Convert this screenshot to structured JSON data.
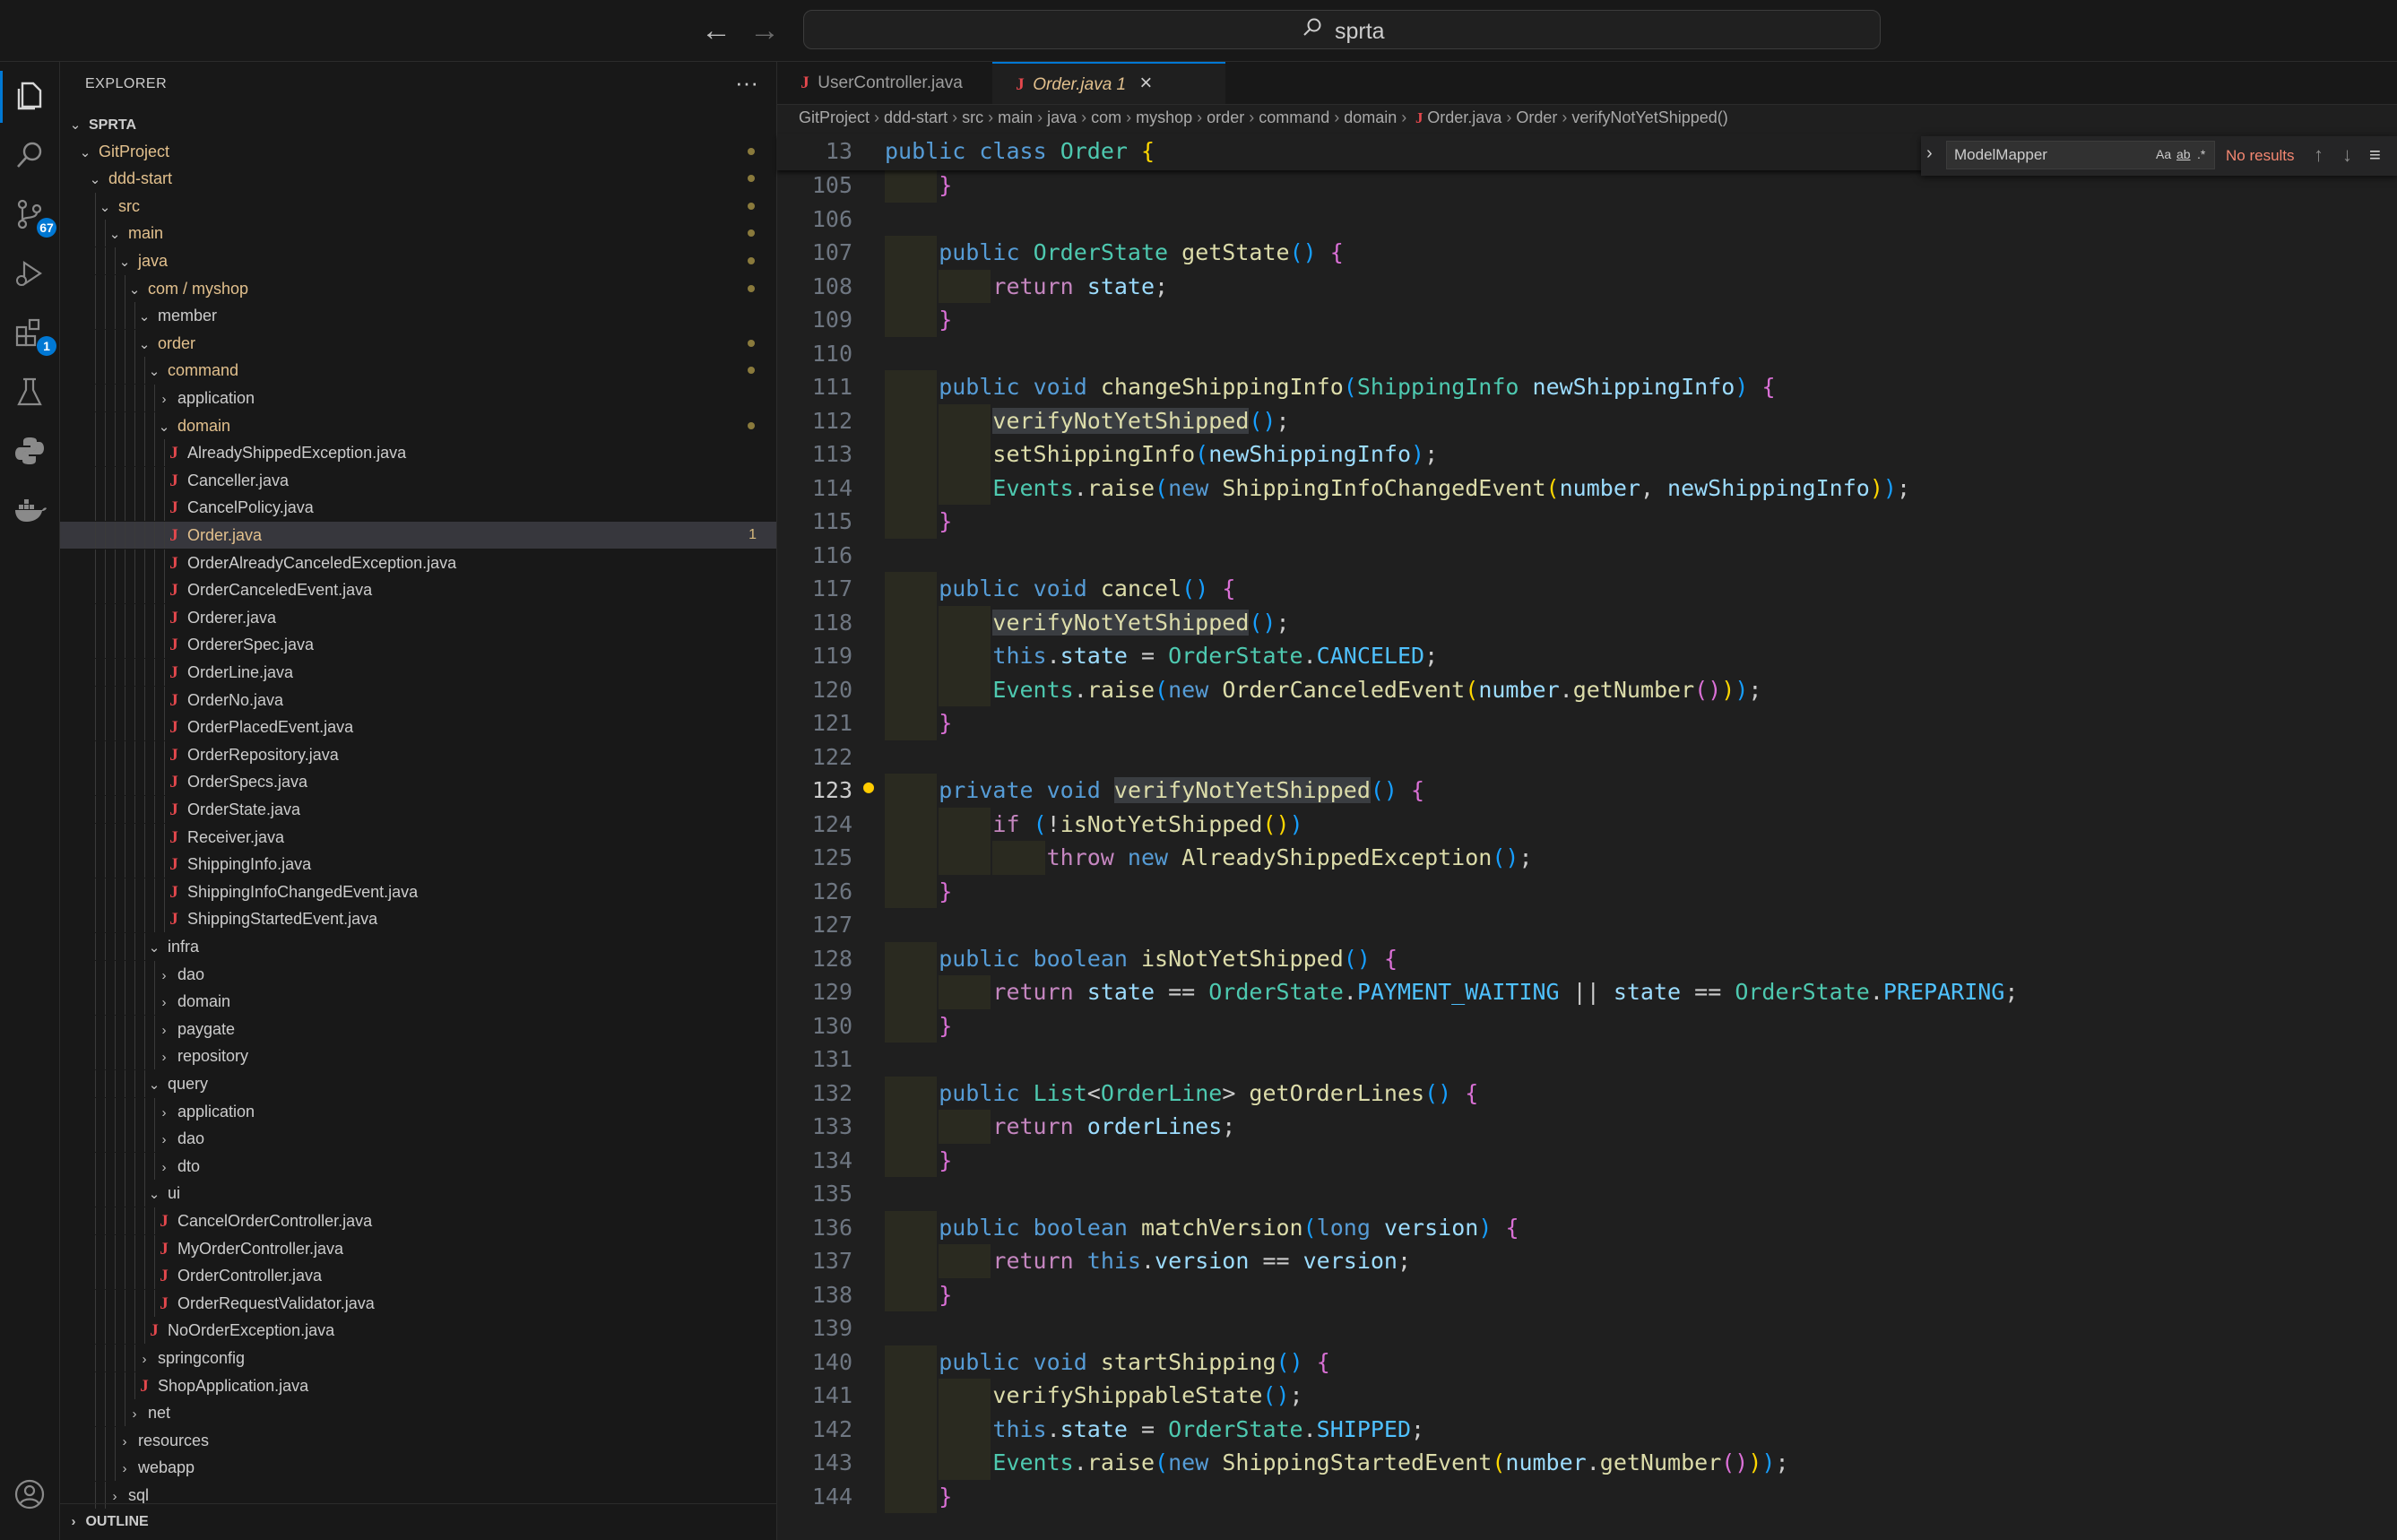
{
  "titlebar": {
    "search_text": "sprta",
    "back_icon": "arrow-left-icon",
    "forward_icon": "arrow-right-icon"
  },
  "activitybar": {
    "scm_badge": "67",
    "extensions_badge": "1"
  },
  "explorer": {
    "title": "EXPLORER",
    "more": "···",
    "outline": "OUTLINE",
    "tree": [
      {
        "label": "SPRTA",
        "depth": 0,
        "chev": "v",
        "bold": true
      },
      {
        "label": "GitProject",
        "depth": 1,
        "chev": "v",
        "mod": true,
        "dot": true
      },
      {
        "label": "ddd-start",
        "depth": 2,
        "chev": "v",
        "mod": true,
        "dot": true
      },
      {
        "label": "src",
        "depth": 3,
        "chev": "v",
        "mod": true,
        "dot": true
      },
      {
        "label": "main",
        "depth": 4,
        "chev": "v",
        "mod": true,
        "dot": true
      },
      {
        "label": "java",
        "depth": 5,
        "chev": "v",
        "mod": true,
        "dot": true
      },
      {
        "label": "com / myshop",
        "depth": 6,
        "chev": "v",
        "mod": true,
        "dot": true
      },
      {
        "label": "member",
        "depth": 7,
        "chev": "v"
      },
      {
        "label": "order",
        "depth": 7,
        "chev": "v",
        "mod": true,
        "dot": true
      },
      {
        "label": "command",
        "depth": 8,
        "chev": "v",
        "mod": true,
        "dot": true
      },
      {
        "label": "application",
        "depth": 9,
        "chev": ">"
      },
      {
        "label": "domain",
        "depth": 9,
        "chev": "v",
        "mod": true,
        "dot": true
      },
      {
        "label": "AlreadyShippedException.java",
        "depth": 10,
        "file": true
      },
      {
        "label": "Canceller.java",
        "depth": 10,
        "file": true
      },
      {
        "label": "CancelPolicy.java",
        "depth": 10,
        "file": true
      },
      {
        "label": "Order.java",
        "depth": 10,
        "file": true,
        "mod": true,
        "sel": true,
        "count": "1"
      },
      {
        "label": "OrderAlreadyCanceledException.java",
        "depth": 10,
        "file": true
      },
      {
        "label": "OrderCanceledEvent.java",
        "depth": 10,
        "file": true
      },
      {
        "label": "Orderer.java",
        "depth": 10,
        "file": true
      },
      {
        "label": "OrdererSpec.java",
        "depth": 10,
        "file": true
      },
      {
        "label": "OrderLine.java",
        "depth": 10,
        "file": true
      },
      {
        "label": "OrderNo.java",
        "depth": 10,
        "file": true
      },
      {
        "label": "OrderPlacedEvent.java",
        "depth": 10,
        "file": true
      },
      {
        "label": "OrderRepository.java",
        "depth": 10,
        "file": true
      },
      {
        "label": "OrderSpecs.java",
        "depth": 10,
        "file": true
      },
      {
        "label": "OrderState.java",
        "depth": 10,
        "file": true
      },
      {
        "label": "Receiver.java",
        "depth": 10,
        "file": true
      },
      {
        "label": "ShippingInfo.java",
        "depth": 10,
        "file": true
      },
      {
        "label": "ShippingInfoChangedEvent.java",
        "depth": 10,
        "file": true
      },
      {
        "label": "ShippingStartedEvent.java",
        "depth": 10,
        "file": true
      },
      {
        "label": "infra",
        "depth": 8,
        "chev": "v"
      },
      {
        "label": "dao",
        "depth": 9,
        "chev": ">"
      },
      {
        "label": "domain",
        "depth": 9,
        "chev": ">"
      },
      {
        "label": "paygate",
        "depth": 9,
        "chev": ">"
      },
      {
        "label": "repository",
        "depth": 9,
        "chev": ">"
      },
      {
        "label": "query",
        "depth": 8,
        "chev": "v"
      },
      {
        "label": "application",
        "depth": 9,
        "chev": ">"
      },
      {
        "label": "dao",
        "depth": 9,
        "chev": ">"
      },
      {
        "label": "dto",
        "depth": 9,
        "chev": ">"
      },
      {
        "label": "ui",
        "depth": 8,
        "chev": "v"
      },
      {
        "label": "CancelOrderController.java",
        "depth": 9,
        "file": true
      },
      {
        "label": "MyOrderController.java",
        "depth": 9,
        "file": true
      },
      {
        "label": "OrderController.java",
        "depth": 9,
        "file": true
      },
      {
        "label": "OrderRequestValidator.java",
        "depth": 9,
        "file": true
      },
      {
        "label": "NoOrderException.java",
        "depth": 8,
        "file": true
      },
      {
        "label": "springconfig",
        "depth": 7,
        "chev": ">"
      },
      {
        "label": "ShopApplication.java",
        "depth": 7,
        "file": true
      },
      {
        "label": "net",
        "depth": 6,
        "chev": ">"
      },
      {
        "label": "resources",
        "depth": 5,
        "chev": ">"
      },
      {
        "label": "webapp",
        "depth": 5,
        "chev": ">"
      },
      {
        "label": "sql",
        "depth": 4,
        "chev": ">"
      }
    ]
  },
  "tabs": [
    {
      "label": "UserController.java",
      "active": false
    },
    {
      "label": "Order.java 1",
      "active": true,
      "close": "×"
    }
  ],
  "breadcrumb": [
    "GitProject",
    "ddd-start",
    "src",
    "main",
    "java",
    "com",
    "myshop",
    "order",
    "command",
    "domain",
    "Order.java",
    "Order",
    "verifyNotYetShipped()"
  ],
  "find": {
    "query": "ModelMapper",
    "case_label": "Aa",
    "word_label": "ab",
    "regex_label": ".*",
    "result": "No results"
  },
  "sticky": {
    "line": "13",
    "html": "<span class=\"kw\">public</span> <span class=\"kw\">class</span> <span class=\"ty\">Order</span> <span class=\"pn\">{</span>"
  },
  "code": [
    {
      "n": "105",
      "i": 1,
      "html": "<span class=\"pn2\">}</span>"
    },
    {
      "n": "106",
      "i": 0,
      "html": ""
    },
    {
      "n": "107",
      "i": 1,
      "html": "<span class=\"kw\">public</span> <span class=\"ty\">OrderState</span> <span class=\"fn\">getState</span><span class=\"pn3\">()</span> <span class=\"pn2\">{</span>"
    },
    {
      "n": "108",
      "i": 2,
      "html": "<span class=\"kw2\">return</span> <span class=\"vr\">state</span>;"
    },
    {
      "n": "109",
      "i": 1,
      "html": "<span class=\"pn2\">}</span>"
    },
    {
      "n": "110",
      "i": 0,
      "html": ""
    },
    {
      "n": "111",
      "i": 1,
      "html": "<span class=\"kw\">public</span> <span class=\"kw\">void</span> <span class=\"fn\">changeShippingInfo</span><span class=\"pn3\">(</span><span class=\"ty\">ShippingInfo</span> <span class=\"vr\">newShippingInfo</span><span class=\"pn3\">)</span> <span class=\"pn2\">{</span>"
    },
    {
      "n": "112",
      "i": 2,
      "html": "<span class=\"fn hl\">verifyNotYetShipped</span><span class=\"pn3\">()</span>;"
    },
    {
      "n": "113",
      "i": 2,
      "html": "<span class=\"fn\">setShippingInfo</span><span class=\"pn3\">(</span><span class=\"vr\">newShippingInfo</span><span class=\"pn3\">)</span>;"
    },
    {
      "n": "114",
      "i": 2,
      "html": "<span class=\"ty\">Events</span>.<span class=\"fn\">raise</span><span class=\"pn3\">(</span><span class=\"kw\">new</span> <span class=\"fn\">ShippingInfoChangedEvent</span><span class=\"pn\">(</span><span class=\"vr\">number</span>, <span class=\"vr\">newShippingInfo</span><span class=\"pn\">)</span><span class=\"pn3\">)</span>;"
    },
    {
      "n": "115",
      "i": 1,
      "html": "<span class=\"pn2\">}</span>"
    },
    {
      "n": "116",
      "i": 0,
      "html": ""
    },
    {
      "n": "117",
      "i": 1,
      "html": "<span class=\"kw\">public</span> <span class=\"kw\">void</span> <span class=\"fn\">cancel</span><span class=\"pn3\">()</span> <span class=\"pn2\">{</span>"
    },
    {
      "n": "118",
      "i": 2,
      "html": "<span class=\"fn hl\">verifyNotYetShipped</span><span class=\"pn3\">()</span>;"
    },
    {
      "n": "119",
      "i": 2,
      "html": "<span class=\"kw\">this</span>.<span class=\"vr\">state</span> = <span class=\"ty\">OrderState</span>.<span class=\"cn\">CANCELED</span>;"
    },
    {
      "n": "120",
      "i": 2,
      "html": "<span class=\"ty\">Events</span>.<span class=\"fn\">raise</span><span class=\"pn3\">(</span><span class=\"kw\">new</span> <span class=\"fn\">OrderCanceledEvent</span><span class=\"pn\">(</span><span class=\"vr\">number</span>.<span class=\"fn\">getNumber</span><span class=\"pn2\">()</span><span class=\"pn\">)</span><span class=\"pn3\">)</span>;"
    },
    {
      "n": "121",
      "i": 1,
      "html": "<span class=\"pn2\">}</span>"
    },
    {
      "n": "122",
      "i": 0,
      "html": ""
    },
    {
      "n": "123",
      "i": 1,
      "cur": true,
      "bulb": true,
      "html": "<span class=\"kw\">private</span> <span class=\"kw\">void</span> <span class=\"fn hl\">verifyNotYetShipped</span><span class=\"pn3\">()</span> <span class=\"pn2\">{</span>"
    },
    {
      "n": "124",
      "i": 2,
      "html": "<span class=\"kw2\">if</span> <span class=\"pn3\">(</span>!<span class=\"fn\">isNotYetShipped</span><span class=\"pn\">()</span><span class=\"pn3\">)</span>"
    },
    {
      "n": "125",
      "i": 3,
      "html": "<span class=\"kw2\">throw</span> <span class=\"kw\">new</span> <span class=\"fn\">AlreadyShippedException</span><span class=\"pn3\">()</span>;"
    },
    {
      "n": "126",
      "i": 1,
      "html": "<span class=\"pn2\">}</span>"
    },
    {
      "n": "127",
      "i": 0,
      "html": ""
    },
    {
      "n": "128",
      "i": 1,
      "html": "<span class=\"kw\">public</span> <span class=\"kw\">boolean</span> <span class=\"fn\">isNotYetShipped</span><span class=\"pn3\">()</span> <span class=\"pn2\">{</span>"
    },
    {
      "n": "129",
      "i": 2,
      "html": "<span class=\"kw2\">return</span> <span class=\"vr\">state</span> == <span class=\"ty\">OrderState</span>.<span class=\"cn\">PAYMENT_WAITING</span> || <span class=\"vr\">state</span> == <span class=\"ty\">OrderState</span>.<span class=\"cn\">PREPARING</span>;"
    },
    {
      "n": "130",
      "i": 1,
      "html": "<span class=\"pn2\">}</span>"
    },
    {
      "n": "131",
      "i": 0,
      "html": ""
    },
    {
      "n": "132",
      "i": 1,
      "html": "<span class=\"kw\">public</span> <span class=\"ty\">List</span>&lt;<span class=\"ty\">OrderLine</span>&gt; <span class=\"fn\">getOrderLines</span><span class=\"pn3\">()</span> <span class=\"pn2\">{</span>"
    },
    {
      "n": "133",
      "i": 2,
      "html": "<span class=\"kw2\">return</span> <span class=\"vr\">orderLines</span>;"
    },
    {
      "n": "134",
      "i": 1,
      "html": "<span class=\"pn2\">}</span>"
    },
    {
      "n": "135",
      "i": 0,
      "html": ""
    },
    {
      "n": "136",
      "i": 1,
      "html": "<span class=\"kw\">public</span> <span class=\"kw\">boolean</span> <span class=\"fn\">matchVersion</span><span class=\"pn3\">(</span><span class=\"kw\">long</span> <span class=\"vr\">version</span><span class=\"pn3\">)</span> <span class=\"pn2\">{</span>"
    },
    {
      "n": "137",
      "i": 2,
      "html": "<span class=\"kw2\">return</span> <span class=\"kw\">this</span>.<span class=\"vr\">version</span> == <span class=\"vr\">version</span>;"
    },
    {
      "n": "138",
      "i": 1,
      "html": "<span class=\"pn2\">}</span>"
    },
    {
      "n": "139",
      "i": 0,
      "html": ""
    },
    {
      "n": "140",
      "i": 1,
      "html": "<span class=\"kw\">public</span> <span class=\"kw\">void</span> <span class=\"fn\">startShipping</span><span class=\"pn3\">()</span> <span class=\"pn2\">{</span>"
    },
    {
      "n": "141",
      "i": 2,
      "html": "<span class=\"fn\">verifyShippableState</span><span class=\"pn3\">()</span>;"
    },
    {
      "n": "142",
      "i": 2,
      "html": "<span class=\"kw\">this</span>.<span class=\"vr\">state</span> = <span class=\"ty\">OrderState</span>.<span class=\"cn\">SHIPPED</span>;"
    },
    {
      "n": "143",
      "i": 2,
      "html": "<span class=\"ty\">Events</span>.<span class=\"fn\">raise</span><span class=\"pn3\">(</span><span class=\"kw\">new</span> <span class=\"fn\">ShippingStartedEvent</span><span class=\"pn\">(</span><span class=\"vr\">number</span>.<span class=\"fn\">getNumber</span><span class=\"pn2\">()</span><span class=\"pn\">)</span><span class=\"pn3\">)</span>;"
    },
    {
      "n": "144",
      "i": 1,
      "html": "<span class=\"pn2\">}</span>"
    }
  ]
}
